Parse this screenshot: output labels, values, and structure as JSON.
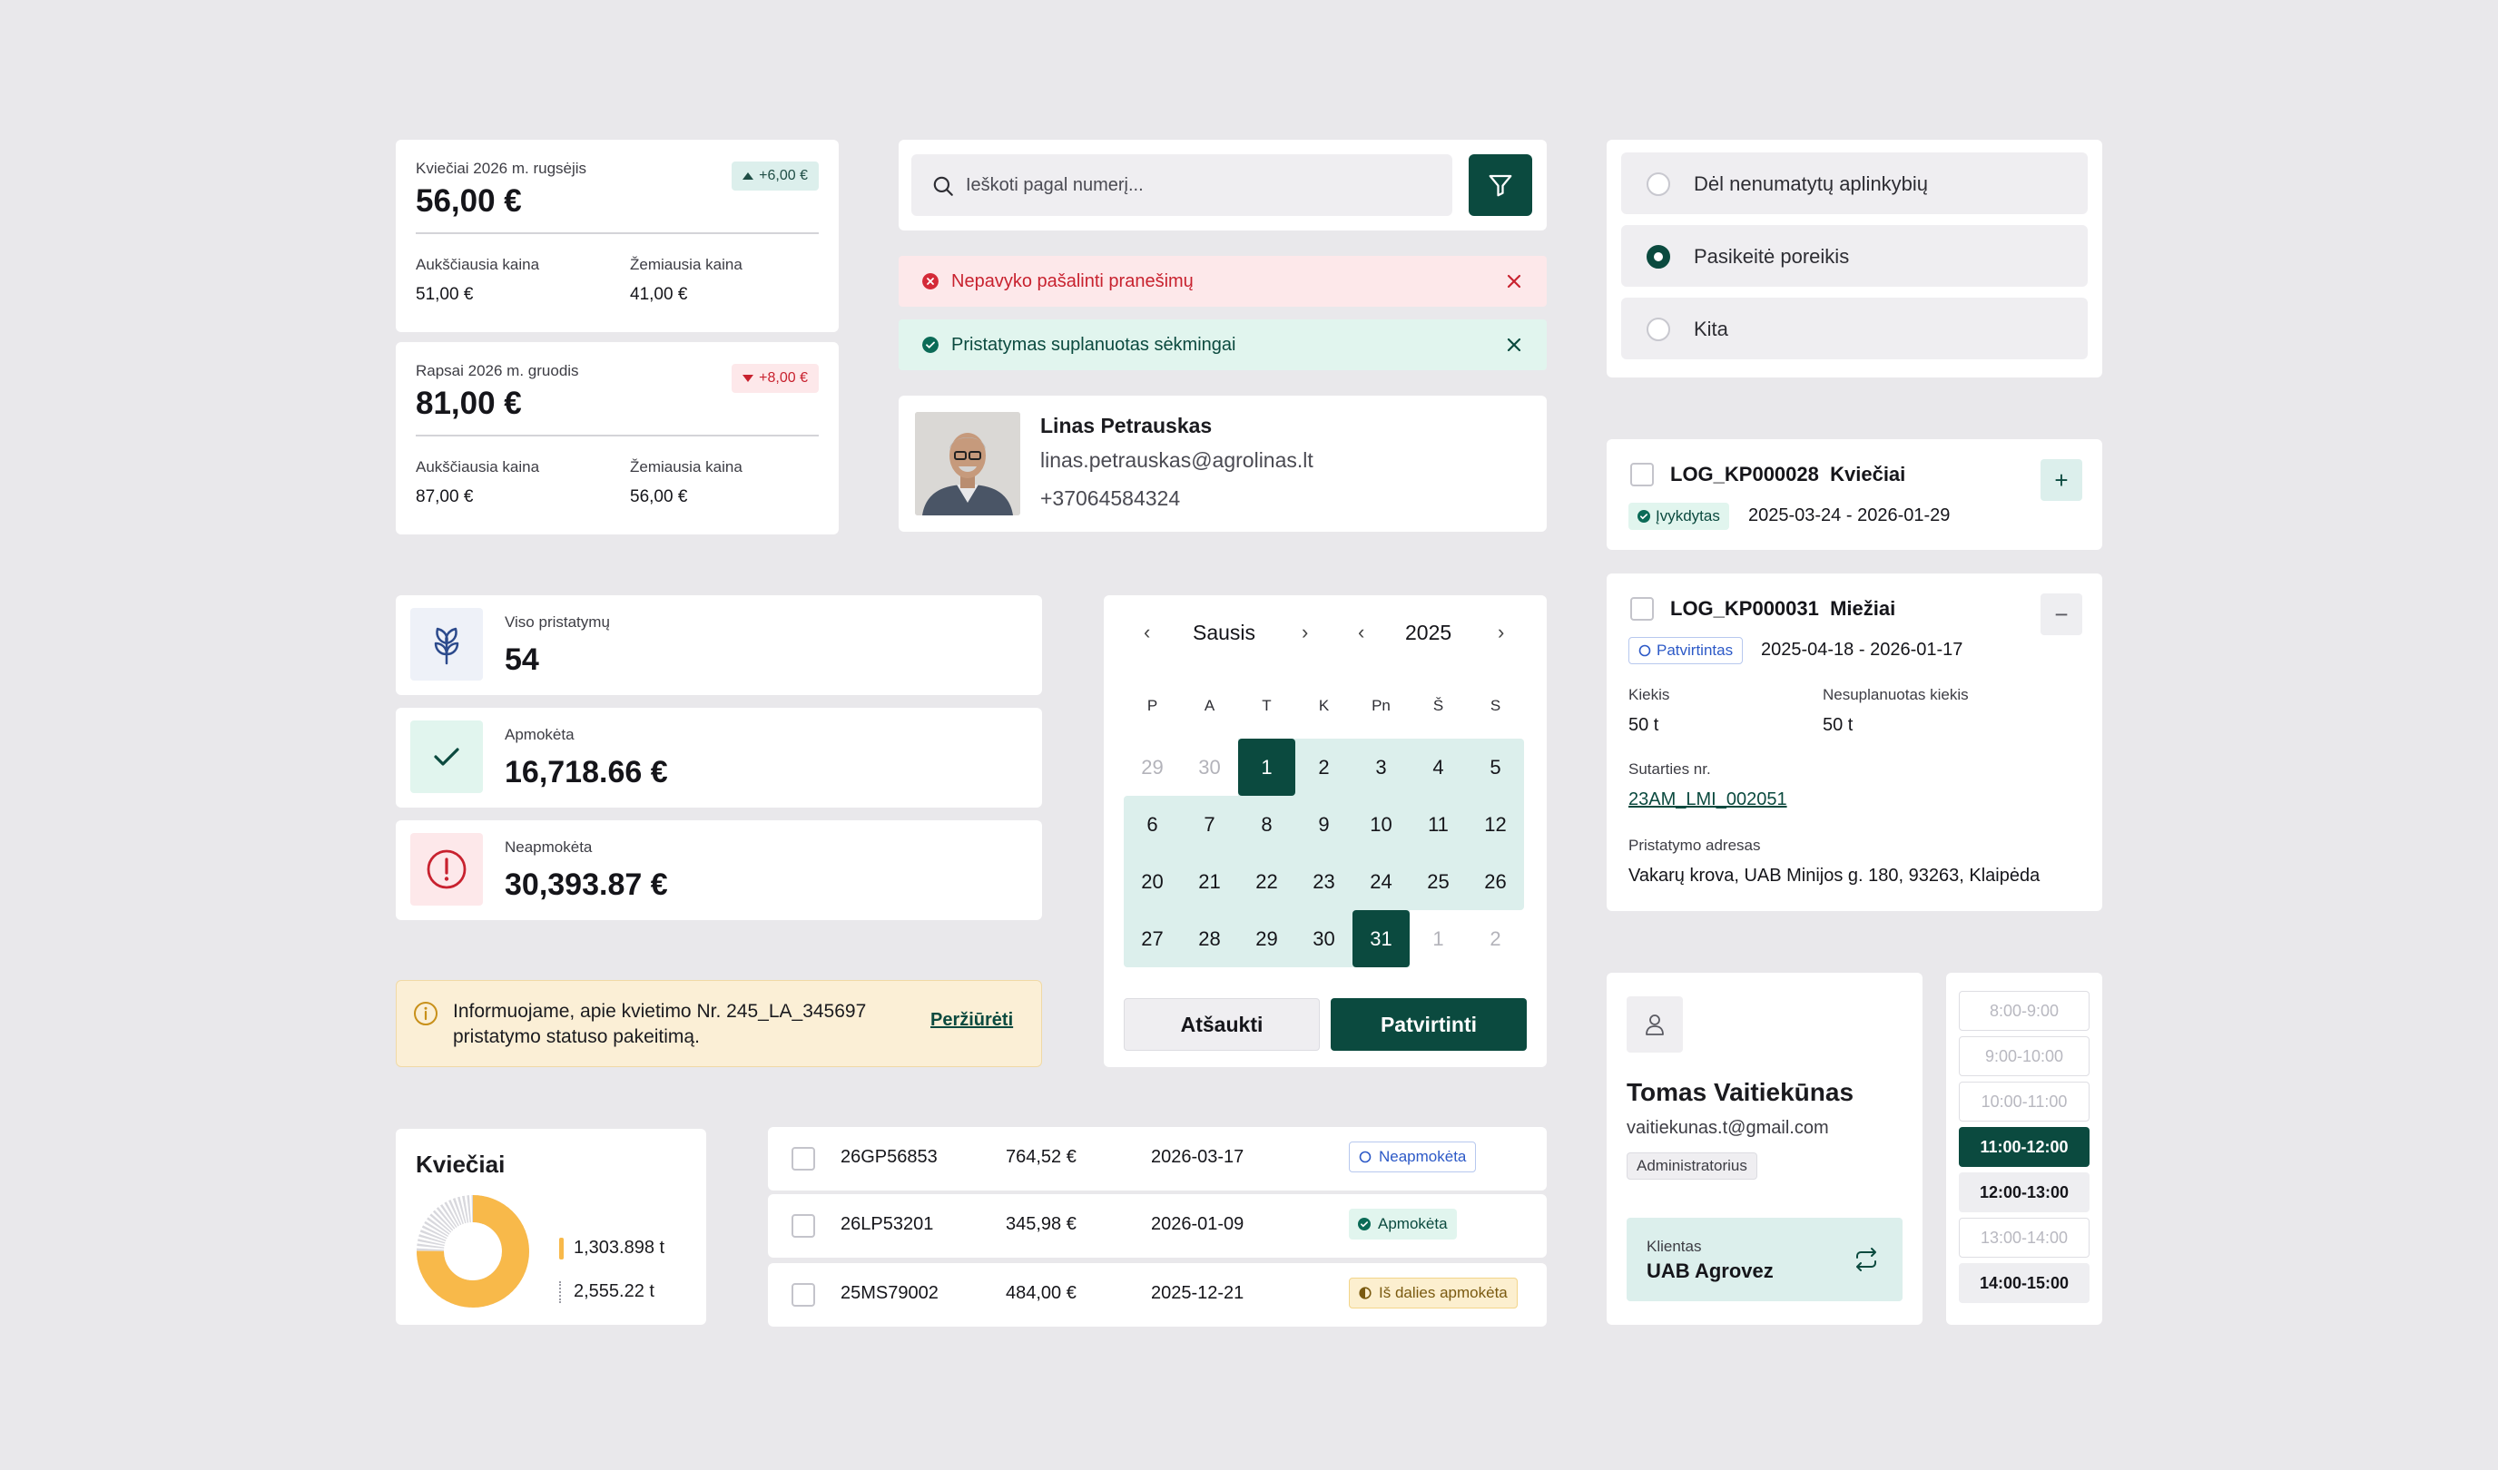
{
  "price_cards": [
    {
      "label": "Kviečiai 2026 m. rugsėjis",
      "value": "56,00 €",
      "change": "+6,00 €",
      "trend": "up",
      "high_label": "Aukščiausia kaina",
      "high_value": "51,00 €",
      "low_label": "Žemiausia kaina",
      "low_value": "41,00 €"
    },
    {
      "label": "Rapsai 2026 m. gruodis",
      "value": "81,00 €",
      "change": "+8,00 €",
      "trend": "down",
      "high_label": "Aukščiausia kaina",
      "high_value": "87,00 €",
      "low_label": "Žemiausia kaina",
      "low_value": "56,00 €"
    }
  ],
  "search": {
    "placeholder": "Ieškoti pagal numerį..."
  },
  "alerts": {
    "error": "Nepavyko pašalinti pranešimų",
    "success": "Pristatymas suplanuotas sėkmingai"
  },
  "contact": {
    "name": "Linas Petrauskas",
    "email": "linas.petrauskas@agrolinas.lt",
    "phone": "+37064584324"
  },
  "reasons": {
    "options": [
      "Dėl nenumatytų aplinkybių",
      "Pasikeitė poreikis",
      "Kita"
    ],
    "selected": "Pasikeitė poreikis"
  },
  "logistics": [
    {
      "code": "LOG_KP000028",
      "crop": "Kviečiai",
      "status": "Įvykdytas",
      "dates": "2025-03-24 - 2026-01-29",
      "action": "+"
    },
    {
      "code": "LOG_KP000031",
      "crop": "Miežiai",
      "status": "Patvirtintas",
      "dates": "2025-04-18 - 2026-01-17",
      "action": "−",
      "qty_label": "Kiekis",
      "qty_value": "50 t",
      "unplanned_label": "Nesuplanuotas kiekis",
      "unplanned_value": "50 t",
      "contract_label": "Sutarties nr.",
      "contract_value": "23AM_LMI_002051",
      "address_label": "Pristatymo adresas",
      "address_value": "Vakarų krova, UAB Minijos g. 180, 93263, Klaipėda"
    }
  ],
  "stats": [
    {
      "label": "Viso pristatymų",
      "value": "54",
      "icon": "sprout-icon"
    },
    {
      "label": "Apmokėta",
      "value": "16,718.66 €",
      "icon": "check-icon"
    },
    {
      "label": "Neapmokėta",
      "value": "30,393.87 €",
      "icon": "alert-circle-icon"
    }
  ],
  "info_banner": {
    "text_line1": "Informuojame, apie kvietimo Nr. 245_LA_345697",
    "text_line2": "pristatymo statuso pakeitimą.",
    "link": "Peržiūrėti"
  },
  "calendar": {
    "month": "Sausis",
    "year": "2025",
    "prev": "‹",
    "next": "›",
    "weekdays": [
      "P",
      "A",
      "T",
      "K",
      "Pn",
      "Š",
      "S"
    ],
    "weeks": [
      [
        "29",
        "30",
        "1",
        "2",
        "3",
        "4",
        "5"
      ],
      [
        "6",
        "7",
        "8",
        "9",
        "10",
        "11",
        "12"
      ],
      [
        "20",
        "21",
        "22",
        "23",
        "24",
        "25",
        "26"
      ],
      [
        "27",
        "28",
        "29",
        "30",
        "31",
        "1",
        "2"
      ]
    ],
    "cancel": "Atšaukti",
    "confirm": "Patvirtinti"
  },
  "donut": {
    "title": "Kviečiai",
    "legend": [
      {
        "value": "1,303.898 t",
        "color": "#f8b94a"
      },
      {
        "value": "2,555.22 t",
        "color": "#cfcfd4"
      }
    ]
  },
  "invoices": [
    {
      "number": "26GP56853",
      "amount": "764,52 €",
      "date": "2026-03-17",
      "status": "Neapmokėta",
      "kind": "unpaid"
    },
    {
      "number": "26LP53201",
      "amount": "345,98 €",
      "date": "2026-01-09",
      "status": "Apmokėta",
      "kind": "paid"
    },
    {
      "number": "25MS79002",
      "amount": "484,00 €",
      "date": "2025-12-21",
      "status": "Iš dalies apmokėta",
      "kind": "partial"
    }
  ],
  "user": {
    "name": "Tomas Vaitiekūnas",
    "email": "vaitiekunas.t@gmail.com",
    "role": "Administratorius",
    "client_label": "Klientas",
    "client_name": "UAB Agrovez"
  },
  "time_slots": [
    {
      "label": "8:00-9:00",
      "state": "disabled"
    },
    {
      "label": "9:00-10:00",
      "state": "disabled"
    },
    {
      "label": "10:00-11:00",
      "state": "disabled"
    },
    {
      "label": "11:00-12:00",
      "state": "selected"
    },
    {
      "label": "12:00-13:00",
      "state": "available"
    },
    {
      "label": "13:00-14:00",
      "state": "disabled"
    },
    {
      "label": "14:00-15:00",
      "state": "available"
    }
  ],
  "colors": {
    "brand": "#0b4a3f",
    "range": "#dcefec",
    "error_bg": "#fde8ea",
    "success_bg": "#e1f5ee",
    "warning_bg": "#fbefd6",
    "donut": "#f8b94a"
  }
}
